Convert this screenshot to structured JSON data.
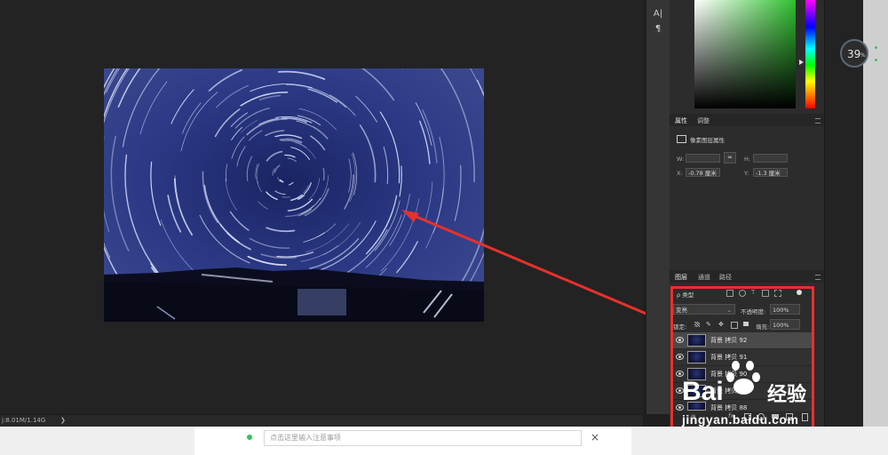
{
  "status_bar": {
    "doc_size": "j:8.01M/1.14G",
    "arrow": "❯"
  },
  "vertical_toolbar": {
    "items": [
      "A|",
      "¶"
    ]
  },
  "properties_panel": {
    "tabs": [
      "属性",
      "调整"
    ],
    "section_title": "像素图层属性",
    "w_label": "W:",
    "h_label": "H:",
    "x_label": "X:",
    "x_value": "-0.78 厘米",
    "y_label": "Y:",
    "y_value": "-1.3 厘米",
    "link_icon": "link-icon"
  },
  "layers_panel": {
    "tabs": [
      "图层",
      "通道",
      "路径"
    ],
    "filter_kind": "ρ 类型",
    "blend_mode": "变亮",
    "opacity_label": "不透明度:",
    "opacity_value": "100%",
    "lock_label": "锁定:",
    "fill_label": "填充:",
    "fill_value": "100%",
    "layers": [
      {
        "name": "背景 拷贝 92",
        "selected": true
      },
      {
        "name": "背景 拷贝 91",
        "selected": false
      },
      {
        "name": "背景 拷贝 90",
        "selected": false
      },
      {
        "name": "背景 拷贝 89",
        "selected": false
      },
      {
        "name": "背景 拷贝 88",
        "selected": false
      }
    ],
    "bottom_icons": [
      "link-icon",
      "fx-icon",
      "mask-icon",
      "adjustment-icon",
      "folder-icon",
      "new-layer-icon",
      "trash-icon"
    ]
  },
  "zoom_badge": {
    "value": "39",
    "unit": "%"
  },
  "note_bar": {
    "placeholder": "点击这里输入注意事项",
    "close": "×"
  },
  "watermark": {
    "brand": "Bai",
    "brand_cn": "经验",
    "url": "jingyan.baidu.com"
  },
  "colors": {
    "accent_red": "#e9302b",
    "panel_bg": "#2c2c2c",
    "canvas_bg": "#232323"
  }
}
